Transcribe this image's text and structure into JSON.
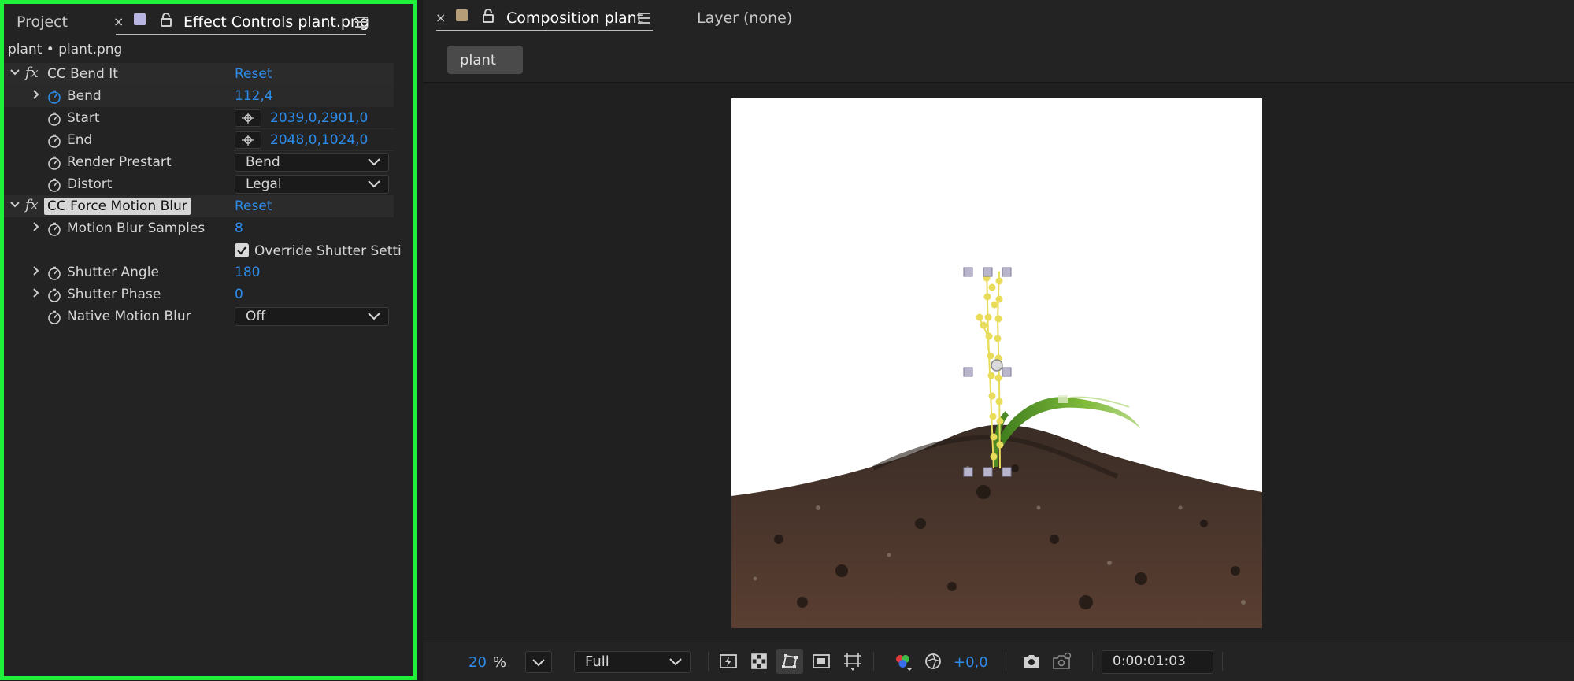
{
  "left_panel": {
    "tabs": [
      {
        "label": "Project"
      },
      {
        "label": "Effect Controls plant.png"
      }
    ],
    "breadcrumb": "plant • plant.png",
    "effects": [
      {
        "name": "CC Bend It",
        "reset": "Reset",
        "properties": [
          {
            "label": "Bend",
            "value": "112,4"
          },
          {
            "label": "Start",
            "value": "2039,0,2901,0"
          },
          {
            "label": "End",
            "value": "2048,0,1024,0"
          },
          {
            "label": "Render Prestart",
            "value": "Bend"
          },
          {
            "label": "Distort",
            "value": "Legal"
          }
        ]
      },
      {
        "name": "CC Force Motion Blur",
        "reset": "Reset",
        "properties": [
          {
            "label": "Motion Blur Samples",
            "value": "8"
          },
          {
            "label": "Override Shutter Setti",
            "value": "checked"
          },
          {
            "label": "Shutter Angle",
            "value": "180"
          },
          {
            "label": "Shutter Phase",
            "value": "0"
          },
          {
            "label": "Native Motion Blur",
            "value": "Off"
          }
        ]
      }
    ]
  },
  "right_panel": {
    "tabs": [
      {
        "label": "Composition plant"
      },
      {
        "label": "Layer (none)"
      }
    ],
    "layer_chip": "plant",
    "toolbar": {
      "zoom_value": "20",
      "zoom_unit": "%",
      "resolution": "Full",
      "exposure": "+0,0",
      "timecode": "0:00:01:03"
    }
  },
  "colors": {
    "accent_blue": "#2d8ceb",
    "focus_border": "#21f03a",
    "path_yellow": "#e8dc5a"
  }
}
